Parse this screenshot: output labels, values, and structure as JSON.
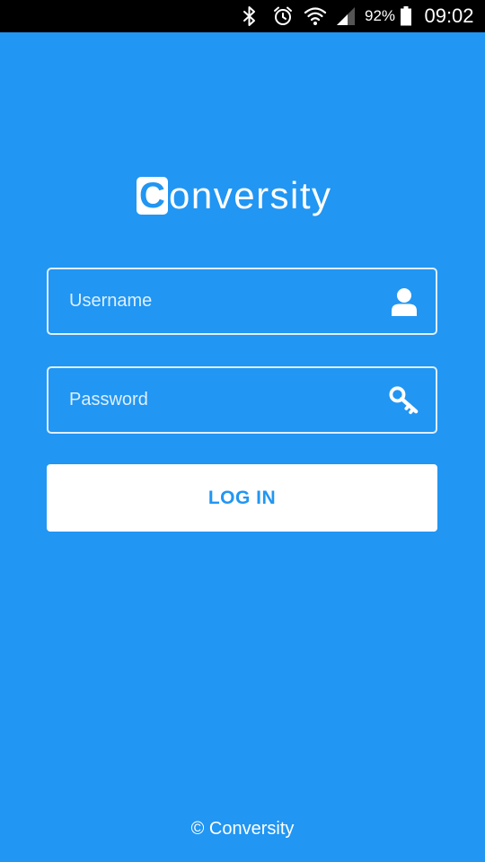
{
  "status_bar": {
    "battery_percent": "92%",
    "time": "09:02",
    "icons": [
      "bluetooth-icon",
      "alarm-icon",
      "wifi-icon",
      "signal-icon",
      "battery-icon"
    ]
  },
  "logo": {
    "first_letter": "C",
    "rest": "onversity"
  },
  "form": {
    "username": {
      "placeholder": "Username",
      "value": "",
      "icon": "user-icon"
    },
    "password": {
      "placeholder": "Password",
      "value": "",
      "icon": "key-icon"
    },
    "login_label": "LOG IN"
  },
  "footer": {
    "text": "© Conversity"
  },
  "colors": {
    "background": "#2196F3",
    "status_bar": "#000000",
    "button_background": "#FFFFFF",
    "button_text": "#2196F3"
  }
}
